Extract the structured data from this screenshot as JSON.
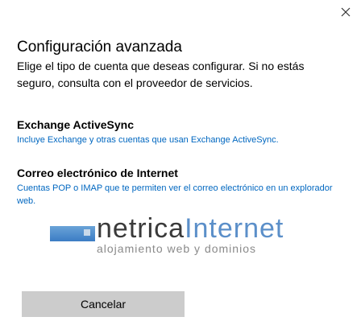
{
  "window": {
    "close_icon": "close-icon"
  },
  "header": {
    "title": "Configuración avanzada",
    "subtitle": "Elige el tipo de cuenta que deseas configurar. Si no estás seguro, consulta con el proveedor de servicios."
  },
  "options": [
    {
      "title": "Exchange ActiveSync",
      "description": "Incluye Exchange y otras cuentas que usan Exchange ActiveSync."
    },
    {
      "title": "Correo electrónico de Internet",
      "description": "Cuentas POP o IMAP que te permiten ver el correo electrónico en un explorador web."
    }
  ],
  "watermark": {
    "word_part1": "netrica",
    "word_part2": "Internet",
    "tagline": "alojamiento web y dominios"
  },
  "footer": {
    "cancel_label": "Cancelar"
  },
  "colors": {
    "link_blue": "#0067c0",
    "button_gray": "#cccccc",
    "logo_blue": "#5b8fc9"
  }
}
